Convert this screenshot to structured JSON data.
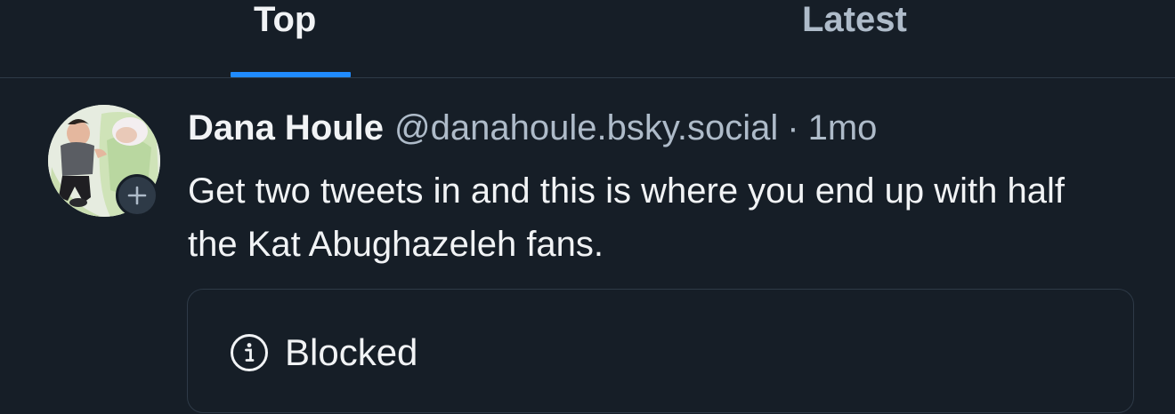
{
  "tabs": [
    {
      "label": "Top",
      "active": true
    },
    {
      "label": "Latest",
      "active": false
    }
  ],
  "post": {
    "author": {
      "display_name": "Dana Houle",
      "handle": "@danahoule.bsky.social"
    },
    "separator": "·",
    "time": "1mo",
    "text": "Get two tweets in and this is where you end up with half the Kat Abughazeleh fans.",
    "embed": {
      "icon": "info-icon",
      "label": "Blocked"
    }
  },
  "colors": {
    "background": "#161e27",
    "accent": "#208bfe",
    "text_primary": "#f1f3f5",
    "text_secondary": "#aebbc9",
    "border": "#2e3a47"
  }
}
